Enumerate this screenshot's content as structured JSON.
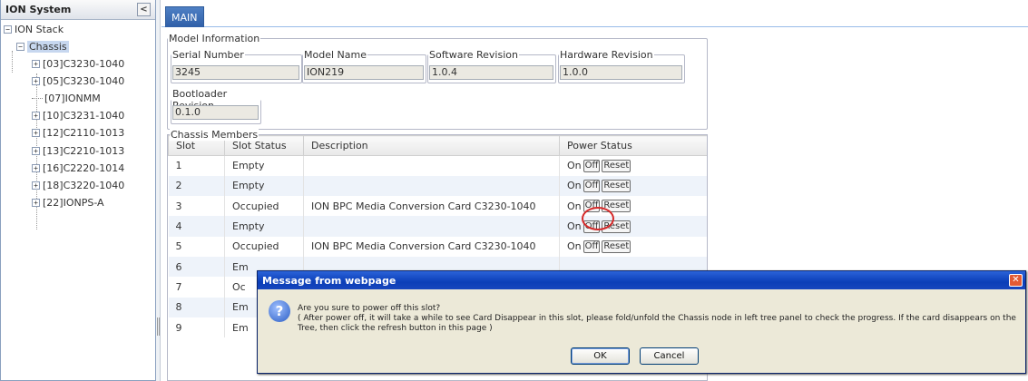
{
  "sidebar": {
    "title": "ION System",
    "collapse_glyph": "<",
    "tree": {
      "root": "ION Stack",
      "chassis": "Chassis",
      "children": [
        {
          "label": "[03]C3230-1040",
          "expandable": true
        },
        {
          "label": "[05]C3230-1040",
          "expandable": true
        },
        {
          "label": "[07]IONMM",
          "expandable": false
        },
        {
          "label": "[10]C3231-1040",
          "expandable": true
        },
        {
          "label": "[12]C2110-1013",
          "expandable": true
        },
        {
          "label": "[13]C2210-1013",
          "expandable": true
        },
        {
          "label": "[16]C2220-1014",
          "expandable": true
        },
        {
          "label": "[18]C3220-1040",
          "expandable": true
        },
        {
          "label": "[22]IONPS-A",
          "expandable": true
        }
      ]
    }
  },
  "tabs": {
    "main": "MAIN"
  },
  "model_info": {
    "legend": "Model Information",
    "serial_number": {
      "label": "Serial Number",
      "value": "3245"
    },
    "model_name": {
      "label": "Model Name",
      "value": "ION219"
    },
    "software_revision": {
      "label": "Software Revision",
      "value": "1.0.4"
    },
    "hardware_revision": {
      "label": "Hardware Revision",
      "value": "1.0.0"
    },
    "bootloader_revision": {
      "label": "Bootloader Revision",
      "value": "0.1.0"
    }
  },
  "chassis_members": {
    "legend": "Chassis Members",
    "columns": [
      "Slot",
      "Slot Status",
      "Description",
      "Power Status"
    ],
    "power_labels": {
      "on": "On",
      "off": "Off",
      "reset": "Reset"
    },
    "rows": [
      {
        "slot": "1",
        "status": "Empty",
        "description": "",
        "power": true
      },
      {
        "slot": "2",
        "status": "Empty",
        "description": "",
        "power": true
      },
      {
        "slot": "3",
        "status": "Occupied",
        "description": "ION BPC Media Conversion Card C3230-1040",
        "power": true
      },
      {
        "slot": "4",
        "status": "Empty",
        "description": "",
        "power": true
      },
      {
        "slot": "5",
        "status": "Occupied",
        "description": "ION BPC Media Conversion Card C3230-1040",
        "power": true
      },
      {
        "slot": "6",
        "status": "Em",
        "description": "",
        "power": false
      },
      {
        "slot": "7",
        "status": "Oc",
        "description": "",
        "power": false
      },
      {
        "slot": "8",
        "status": "Em",
        "description": "",
        "power": false
      },
      {
        "slot": "9",
        "status": "Em",
        "description": "",
        "power": false
      }
    ]
  },
  "dialog": {
    "title": "Message from webpage",
    "close_glyph": "✕",
    "icon_glyph": "?",
    "line1": "Are you sure to power off this slot?",
    "line2": "( After power off, it will take a while to see Card Disappear in this slot, please fold/unfold the Chassis node in left tree panel to check the progress. If the card disappears on the Tree, then click the refresh button in this page )",
    "ok": "OK",
    "cancel": "Cancel"
  },
  "colors": {
    "tab_active": "#2f5fa8",
    "dialog_title": "#0b3eb8",
    "highlight_circle": "#d62a2a"
  }
}
